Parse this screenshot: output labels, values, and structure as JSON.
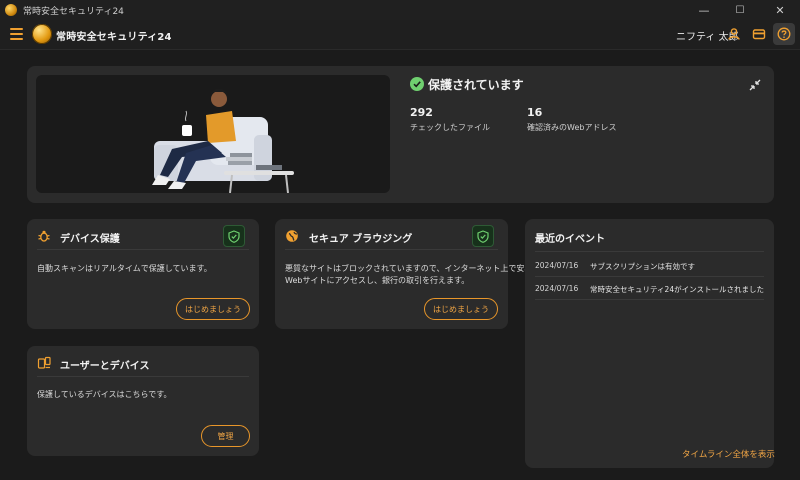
{
  "window": {
    "title": "常時安全セキュリティ24",
    "minimize": "—",
    "maximize": "☐",
    "close": "✕"
  },
  "header": {
    "brand": "常時安全セキュリティ24",
    "user_name": "ニフティ 太郎"
  },
  "colors": {
    "accent": "#f0a030",
    "ok": "#6fcf6f",
    "card": "#2b2b2b",
    "background": "#1b1b1b"
  },
  "protection": {
    "status": "保護されています",
    "stats": [
      {
        "value": "292",
        "label": "チェックしたファイル"
      },
      {
        "value": "16",
        "label": "確認済みのWebアドレス"
      }
    ]
  },
  "cards": {
    "device": {
      "title": "デバイス保護",
      "description": "自動スキャンはリアルタイムで保護しています。",
      "button": "はじめましょう",
      "icon": "bug-shield-icon"
    },
    "browsing": {
      "title": "セキュア ブラウジング",
      "description_line1": "悪質なサイトはブロックされていますので、インターネット上で安心して",
      "description_line2": "Webサイトにアクセスし、銀行の取引を行えます。",
      "button": "はじめましょう",
      "icon": "globe-icon"
    },
    "users": {
      "title": "ユーザーとデバイス",
      "description": "保護しているデバイスはこちらです。",
      "button": "管理",
      "icon": "devices-icon"
    }
  },
  "events": {
    "title": "最近のイベント",
    "items": [
      {
        "date": "2024/07/16",
        "text": "サブスクリプションは有効です"
      },
      {
        "date": "2024/07/16",
        "text": "常時安全セキュリティ24がインストールされました"
      }
    ],
    "link": "タイムライン全体を表示"
  }
}
